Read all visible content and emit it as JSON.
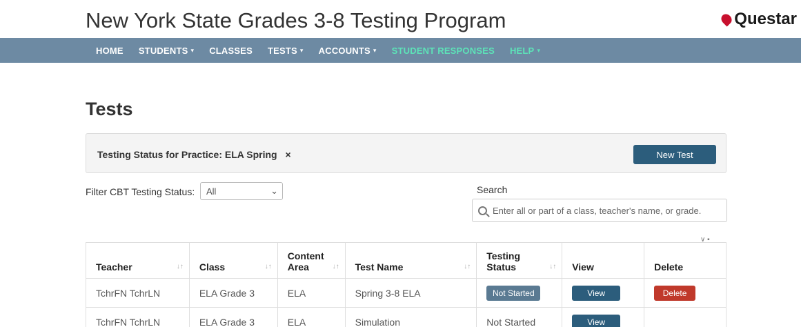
{
  "app": {
    "title": "New York State Grades 3-8 Testing Program",
    "brand": "Questar"
  },
  "nav": {
    "items": [
      {
        "label": "HOME",
        "dropdown": false
      },
      {
        "label": "STUDENTS",
        "dropdown": true
      },
      {
        "label": "CLASSES",
        "dropdown": false
      },
      {
        "label": "TESTS",
        "dropdown": true
      },
      {
        "label": "ACCOUNTS",
        "dropdown": true
      },
      {
        "label": "STUDENT RESPONSES",
        "dropdown": false
      },
      {
        "label": "HELP",
        "dropdown": true
      }
    ]
  },
  "page": {
    "title": "Tests"
  },
  "status_panel": {
    "label": "Testing Status for Practice: ELA Spring ",
    "filter_value": "×",
    "new_test_button": "New Test"
  },
  "filters": {
    "cbt_label": "Filter CBT Testing Status:",
    "cbt_selected": "All",
    "search_label": "Search",
    "search_placeholder": "Enter all or part of a class, teacher's name, or grade."
  },
  "table": {
    "headers": [
      "Teacher",
      "Class",
      "Content Area",
      "Test Name",
      "Testing Status",
      "View",
      "Delete"
    ],
    "rows": [
      {
        "teacher": "TchrFN TchrLN",
        "class": "ELA Grade 3",
        "content_area": "ELA",
        "test_name": "Spring 3-8 ELA",
        "status": "Not Started",
        "view": "View",
        "delete": "Delete"
      },
      {
        "teacher": "TchrFN TchrLN",
        "class": "ELA Grade 3",
        "content_area": "ELA",
        "test_name": "Simulation",
        "status": "Not Started",
        "view": "View",
        "delete": ""
      }
    ]
  },
  "colors": {
    "nav_bg": "#6d8aa3",
    "nav_active": "#5de3b8",
    "primary_button": "#2c5d7c",
    "brand_mark": "#c8102e"
  }
}
